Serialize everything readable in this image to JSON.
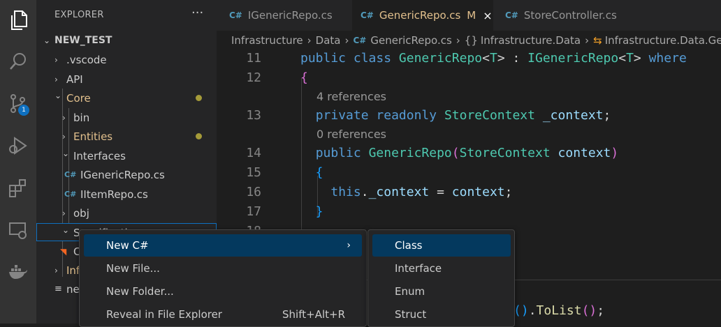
{
  "explorer": {
    "title": "EXPLORER",
    "more": "···",
    "root": "NEW_TEST",
    "items": [
      {
        "label": ".vscode",
        "chev": "›"
      },
      {
        "label": "API",
        "chev": "›"
      },
      {
        "label": "Core",
        "chev": "⌄"
      },
      {
        "label": "bin",
        "chev": "›"
      },
      {
        "label": "Entities",
        "chev": "›"
      },
      {
        "label": "Interfaces",
        "chev": "⌄"
      },
      {
        "label": "IGenericRepo.cs",
        "icon": "C#"
      },
      {
        "label": "IItemRepo.cs",
        "icon": "C#"
      },
      {
        "label": "obj",
        "chev": "›"
      },
      {
        "label": "Specification",
        "chev": "⌄"
      },
      {
        "label": "C"
      },
      {
        "label": "Inf",
        "chev": "›"
      },
      {
        "label": "ne"
      }
    ]
  },
  "activity": {
    "scm_badge": "1"
  },
  "tabs": [
    {
      "label": "IGenericRepo.cs",
      "icon": "C#"
    },
    {
      "label": "GenericRepo.cs",
      "icon": "C#",
      "modified": "M",
      "close": "×"
    },
    {
      "label": "StoreController.cs",
      "icon": "C#"
    }
  ],
  "breadcrumb": [
    "Infrastructure",
    "›",
    "Data",
    "›",
    "C#",
    "GenericRepo.cs",
    "›",
    "{}",
    "Infrastructure.Data",
    "›",
    "⇆",
    "Infrastructure.Data.Gene"
  ],
  "editor": {
    "line_numbers": [
      "11",
      "12",
      "13",
      "14",
      "15",
      "16",
      "17",
      "18"
    ],
    "refs": [
      "4 references",
      "0 references"
    ],
    "tail_code": "().ToList();"
  },
  "context_menu": {
    "items": [
      {
        "label": "New C#",
        "arrow": "›"
      },
      {
        "label": "New File..."
      },
      {
        "label": "New Folder..."
      },
      {
        "label": "Reveal in File Explorer",
        "shortcut": "Shift+Alt+R"
      }
    ]
  },
  "submenu": {
    "items": [
      "Class",
      "Interface",
      "Enum",
      "Struct"
    ]
  },
  "colors": {
    "accent": "#0e70c0",
    "modified": "#e2c08d",
    "menu_highlight": "#04395e"
  }
}
